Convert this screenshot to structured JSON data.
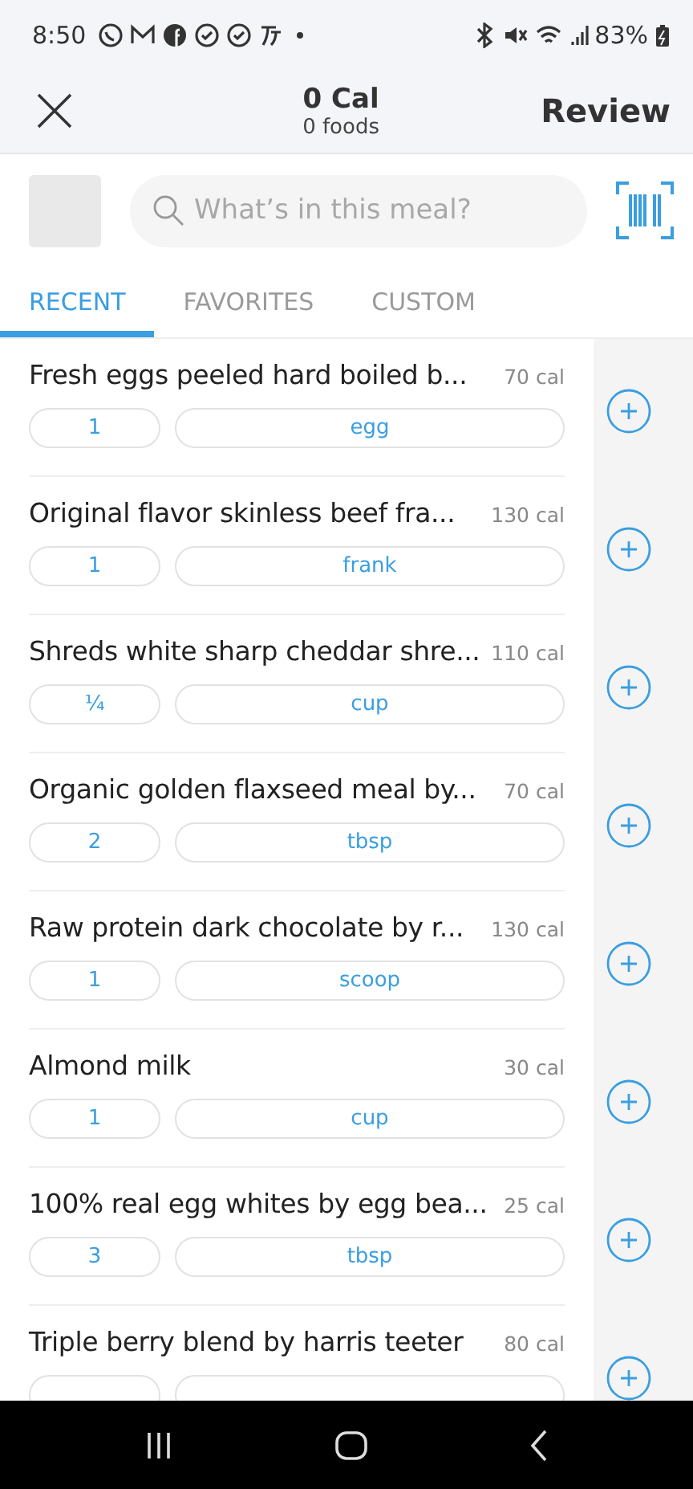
{
  "status_bar": {
    "time": "8:50",
    "battery": "83%"
  },
  "header": {
    "calories": "0 Cal",
    "foods": "0 foods",
    "action": "Review"
  },
  "search": {
    "placeholder": "What’s in this meal?"
  },
  "tabs": [
    {
      "label": "RECENT",
      "selected": true
    },
    {
      "label": "FAVORITES",
      "selected": false
    },
    {
      "label": "CUSTOM",
      "selected": false
    }
  ],
  "foods": [
    {
      "name": "Fresh eggs peeled hard boiled b...",
      "calories": "70 cal",
      "quantity": "1",
      "unit": "egg"
    },
    {
      "name": "Original flavor skinless beef fra...",
      "calories": "130 cal",
      "quantity": "1",
      "unit": "frank"
    },
    {
      "name": "Shreds white sharp cheddar shre...",
      "calories": "110 cal",
      "quantity": "¼",
      "unit": "cup"
    },
    {
      "name": "Organic golden flaxseed meal by...",
      "calories": "70 cal",
      "quantity": "2",
      "unit": "tbsp"
    },
    {
      "name": "Raw protein dark chocolate by r...",
      "calories": "130 cal",
      "quantity": "1",
      "unit": "scoop"
    },
    {
      "name": "Almond milk",
      "calories": "30 cal",
      "quantity": "1",
      "unit": "cup"
    },
    {
      "name": "100% real egg whites by egg bea...",
      "calories": "25 cal",
      "quantity": "3",
      "unit": "tbsp"
    },
    {
      "name": "Triple berry blend by harris teeter",
      "calories": "80 cal"
    }
  ]
}
